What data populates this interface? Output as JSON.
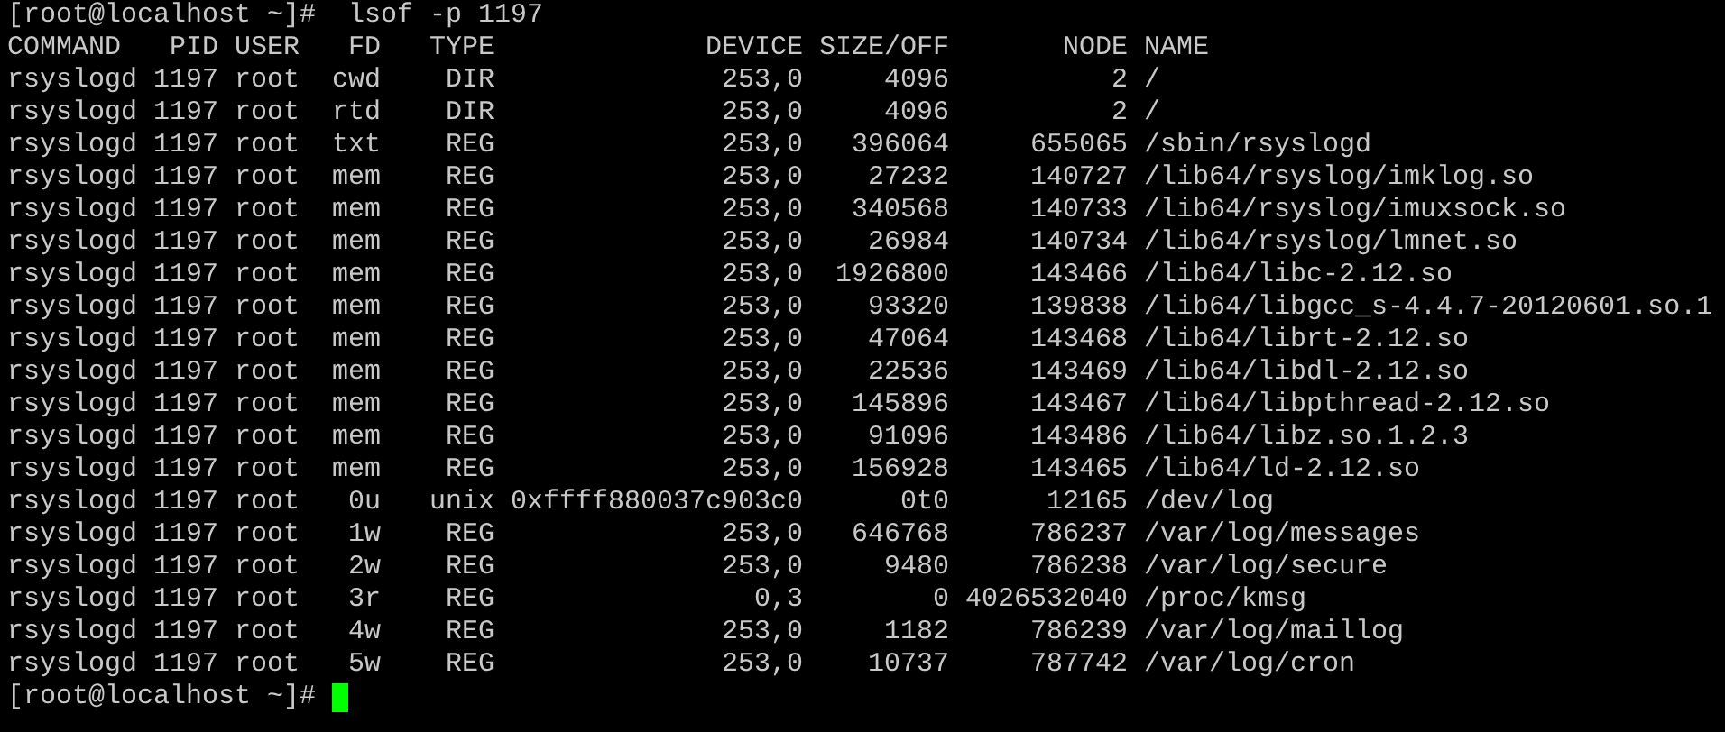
{
  "prompt_line": {
    "prompt": "[root@localhost ~]#",
    "command": "lsof -p 1197"
  },
  "table": {
    "columns": [
      "COMMAND",
      "PID",
      "USER",
      "FD",
      "TYPE",
      "DEVICE",
      "SIZE/OFF",
      "NODE",
      "NAME"
    ],
    "rows": [
      [
        "rsyslogd",
        "1197",
        "root",
        "cwd",
        "DIR",
        "253,0",
        "4096",
        "2",
        "/"
      ],
      [
        "rsyslogd",
        "1197",
        "root",
        "rtd",
        "DIR",
        "253,0",
        "4096",
        "2",
        "/"
      ],
      [
        "rsyslogd",
        "1197",
        "root",
        "txt",
        "REG",
        "253,0",
        "396064",
        "655065",
        "/sbin/rsyslogd"
      ],
      [
        "rsyslogd",
        "1197",
        "root",
        "mem",
        "REG",
        "253,0",
        "27232",
        "140727",
        "/lib64/rsyslog/imklog.so"
      ],
      [
        "rsyslogd",
        "1197",
        "root",
        "mem",
        "REG",
        "253,0",
        "340568",
        "140733",
        "/lib64/rsyslog/imuxsock.so"
      ],
      [
        "rsyslogd",
        "1197",
        "root",
        "mem",
        "REG",
        "253,0",
        "26984",
        "140734",
        "/lib64/rsyslog/lmnet.so"
      ],
      [
        "rsyslogd",
        "1197",
        "root",
        "mem",
        "REG",
        "253,0",
        "1926800",
        "143466",
        "/lib64/libc-2.12.so"
      ],
      [
        "rsyslogd",
        "1197",
        "root",
        "mem",
        "REG",
        "253,0",
        "93320",
        "139838",
        "/lib64/libgcc_s-4.4.7-20120601.so.1"
      ],
      [
        "rsyslogd",
        "1197",
        "root",
        "mem",
        "REG",
        "253,0",
        "47064",
        "143468",
        "/lib64/librt-2.12.so"
      ],
      [
        "rsyslogd",
        "1197",
        "root",
        "mem",
        "REG",
        "253,0",
        "22536",
        "143469",
        "/lib64/libdl-2.12.so"
      ],
      [
        "rsyslogd",
        "1197",
        "root",
        "mem",
        "REG",
        "253,0",
        "145896",
        "143467",
        "/lib64/libpthread-2.12.so"
      ],
      [
        "rsyslogd",
        "1197",
        "root",
        "mem",
        "REG",
        "253,0",
        "91096",
        "143486",
        "/lib64/libz.so.1.2.3"
      ],
      [
        "rsyslogd",
        "1197",
        "root",
        "mem",
        "REG",
        "253,0",
        "156928",
        "143465",
        "/lib64/ld-2.12.so"
      ],
      [
        "rsyslogd",
        "1197",
        "root",
        "0u",
        "unix",
        "0xffff880037c903c0",
        "0t0",
        "12165",
        "/dev/log"
      ],
      [
        "rsyslogd",
        "1197",
        "root",
        "1w",
        "REG",
        "253,0",
        "646768",
        "786237",
        "/var/log/messages"
      ],
      [
        "rsyslogd",
        "1197",
        "root",
        "2w",
        "REG",
        "253,0",
        "9480",
        "786238",
        "/var/log/secure"
      ],
      [
        "rsyslogd",
        "1197",
        "root",
        "3r",
        "REG",
        "0,3",
        "0",
        "4026532040",
        "/proc/kmsg"
      ],
      [
        "rsyslogd",
        "1197",
        "root",
        "4w",
        "REG",
        "253,0",
        "1182",
        "786239",
        "/var/log/maillog"
      ],
      [
        "rsyslogd",
        "1197",
        "root",
        "5w",
        "REG",
        "253,0",
        "10737",
        "787742",
        "/var/log/cron"
      ]
    ]
  },
  "final_prompt": {
    "prompt": "[root@localhost ~]#"
  }
}
